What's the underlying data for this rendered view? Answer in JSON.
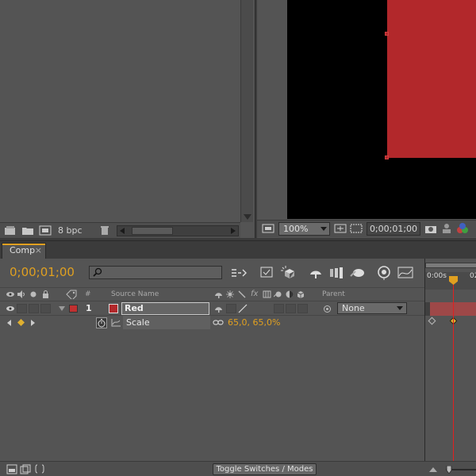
{
  "project": {
    "bpc_label": "8 bpc"
  },
  "viewer": {
    "zoom_value": "100%",
    "time_display": "0;00;01;00"
  },
  "timeline": {
    "tab_label": "Comp",
    "tab_close": "×",
    "current_time": "0;00;01;00",
    "columns": {
      "number": "#",
      "source_name": "Source Name",
      "parent": "Parent"
    },
    "layer": {
      "number": "1",
      "name": "Red",
      "parent_value": "None",
      "label_color": "#c03030",
      "solid_color": "#b2282b"
    },
    "property": {
      "name": "Scale",
      "value": "65,0, 65,0%"
    },
    "ruler": {
      "start_label": "0:00s",
      "next_label": "02"
    },
    "footer": {
      "toggle_label": "Toggle Switches / Modes"
    }
  },
  "colors": {
    "accent_time": "#e0a020",
    "playhead": "#e02020",
    "solid": "#b2282b"
  }
}
